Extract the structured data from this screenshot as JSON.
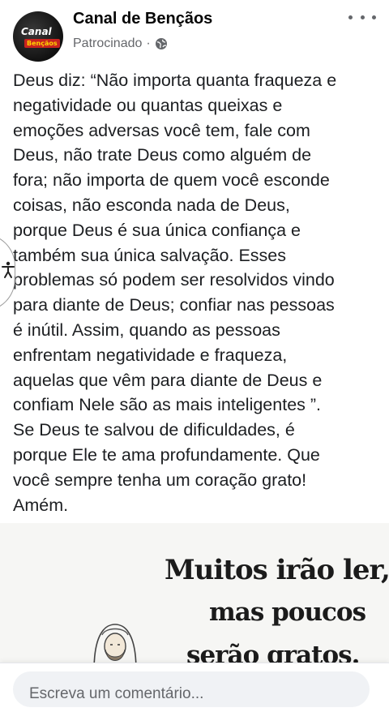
{
  "post": {
    "page_name": "Canal de Bençãos",
    "sponsored_label": "Patrocinado",
    "separator": "·",
    "avatar_text_top": "Canal",
    "avatar_text_bottom": "Bençãos",
    "body": "Deus diz: “Não importa quanta fraqueza e\nnegatividade ou quantas queixas e\nemoções adversas você tem, fale com\nDeus, não trate Deus como alguém de\nfora; não importa de quem você esconde\ncoisas, não esconda nada de Deus,\nporque Deus é sua única confiança e\ntambém sua única salvação. Esses\nproblemas só podem ser resolvidos vindo\npara diante de Deus; confiar nas pessoas\né inútil. Assim, quando as pessoas\nenfrentam negatividade e fraqueza,\naquelas que vêm para diante de Deus e\nconfiam Nele são as mais inteligentes ”.\nSe Deus te salvou de dificuldades, é\nporque Ele te ama profundamente. Que\nvocê sempre tenha um coração grato!\nAmém."
  },
  "image": {
    "line1": "Muitos irão ler,",
    "line2": "mas poucos",
    "line3": "serão gratos."
  },
  "comment": {
    "placeholder": "Escreva um comentário..."
  },
  "icons": {
    "more": "more-options-icon",
    "globe": "globe-icon",
    "accessibility": "accessibility-icon"
  },
  "colors": {
    "text": "#1c1e21",
    "secondary": "#65676b",
    "accent_red": "#c8231f"
  }
}
